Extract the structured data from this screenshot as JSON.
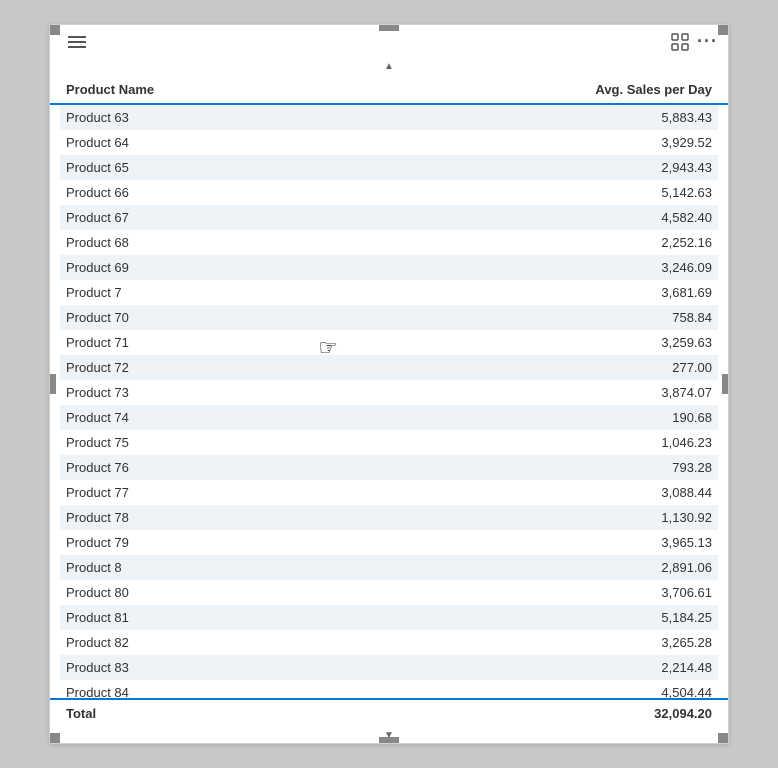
{
  "toolbar": {
    "hamburger_label": "menu",
    "focus_label": "focus",
    "more_label": "more options"
  },
  "table": {
    "columns": [
      {
        "key": "product_name",
        "label": "Product Name"
      },
      {
        "key": "avg_sales",
        "label": "Avg. Sales per Day"
      }
    ],
    "rows": [
      {
        "product_name": "Product 63",
        "avg_sales": "5,883.43"
      },
      {
        "product_name": "Product 64",
        "avg_sales": "3,929.52"
      },
      {
        "product_name": "Product 65",
        "avg_sales": "2,943.43"
      },
      {
        "product_name": "Product 66",
        "avg_sales": "5,142.63"
      },
      {
        "product_name": "Product 67",
        "avg_sales": "4,582.40"
      },
      {
        "product_name": "Product 68",
        "avg_sales": "2,252.16"
      },
      {
        "product_name": "Product 69",
        "avg_sales": "3,246.09"
      },
      {
        "product_name": "Product 7",
        "avg_sales": "3,681.69"
      },
      {
        "product_name": "Product 70",
        "avg_sales": "758.84"
      },
      {
        "product_name": "Product 71",
        "avg_sales": "3,259.63"
      },
      {
        "product_name": "Product 72",
        "avg_sales": "277.00"
      },
      {
        "product_name": "Product 73",
        "avg_sales": "3,874.07"
      },
      {
        "product_name": "Product 74",
        "avg_sales": "190.68"
      },
      {
        "product_name": "Product 75",
        "avg_sales": "1,046.23"
      },
      {
        "product_name": "Product 76",
        "avg_sales": "793.28"
      },
      {
        "product_name": "Product 77",
        "avg_sales": "3,088.44"
      },
      {
        "product_name": "Product 78",
        "avg_sales": "1,130.92"
      },
      {
        "product_name": "Product 79",
        "avg_sales": "3,965.13"
      },
      {
        "product_name": "Product 8",
        "avg_sales": "2,891.06"
      },
      {
        "product_name": "Product 80",
        "avg_sales": "3,706.61"
      },
      {
        "product_name": "Product 81",
        "avg_sales": "5,184.25"
      },
      {
        "product_name": "Product 82",
        "avg_sales": "3,265.28"
      },
      {
        "product_name": "Product 83",
        "avg_sales": "2,214.48"
      },
      {
        "product_name": "Product 84",
        "avg_sales": "4,504.44"
      }
    ],
    "footer": {
      "label": "Total",
      "value": "32,094.20"
    }
  }
}
